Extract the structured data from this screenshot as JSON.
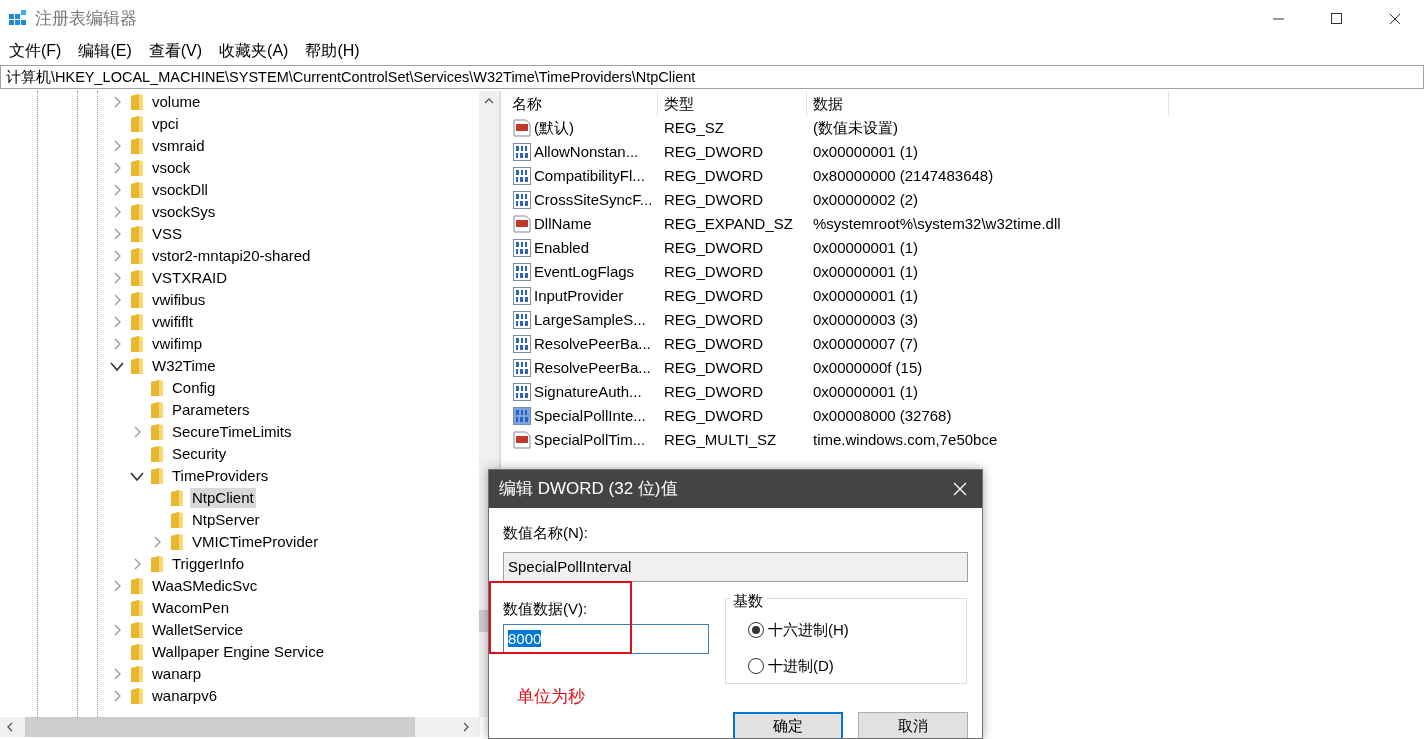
{
  "window": {
    "title": "注册表编辑器"
  },
  "menu": [
    "文件(F)",
    "编辑(E)",
    "查看(V)",
    "收藏夹(A)",
    "帮助(H)"
  ],
  "address": "计算机\\HKEY_LOCAL_MACHINE\\SYSTEM\\CurrentControlSet\\Services\\W32Time\\TimeProviders\\NtpClient",
  "tree": [
    {
      "label": "volume",
      "kind": "node",
      "expanded": false,
      "selected": false
    },
    {
      "label": "vpci",
      "kind": "leaf",
      "selected": false
    },
    {
      "label": "vsmraid",
      "kind": "node",
      "expanded": false,
      "selected": false
    },
    {
      "label": "vsock",
      "kind": "node",
      "expanded": false,
      "selected": false
    },
    {
      "label": "vsockDll",
      "kind": "node",
      "expanded": false,
      "selected": false
    },
    {
      "label": "vsockSys",
      "kind": "node",
      "expanded": false,
      "selected": false
    },
    {
      "label": "VSS",
      "kind": "node",
      "expanded": false,
      "selected": false
    },
    {
      "label": "vstor2-mntapi20-shared",
      "kind": "node",
      "expanded": false,
      "selected": false
    },
    {
      "label": "VSTXRAID",
      "kind": "node",
      "expanded": false,
      "selected": false
    },
    {
      "label": "vwifibus",
      "kind": "node",
      "expanded": false,
      "selected": false
    },
    {
      "label": "vwififlt",
      "kind": "node",
      "expanded": false,
      "selected": false
    },
    {
      "label": "vwifimp",
      "kind": "node",
      "expanded": false,
      "selected": false
    },
    {
      "label": "W32Time",
      "kind": "node",
      "expanded": true,
      "selected": false,
      "children": [
        {
          "label": "Config",
          "kind": "leaf",
          "selected": false
        },
        {
          "label": "Parameters",
          "kind": "leaf",
          "selected": false
        },
        {
          "label": "SecureTimeLimits",
          "kind": "node",
          "expanded": false,
          "selected": false
        },
        {
          "label": "Security",
          "kind": "leaf",
          "selected": false
        },
        {
          "label": "TimeProviders",
          "kind": "node",
          "expanded": true,
          "selected": false,
          "children": [
            {
              "label": "NtpClient",
              "kind": "leaf",
              "selected": true
            },
            {
              "label": "NtpServer",
              "kind": "leaf",
              "selected": false
            },
            {
              "label": "VMICTimeProvider",
              "kind": "node",
              "expanded": false,
              "selected": false
            }
          ]
        },
        {
          "label": "TriggerInfo",
          "kind": "node",
          "expanded": false,
          "selected": false
        }
      ]
    },
    {
      "label": "WaaSMedicSvc",
      "kind": "node",
      "expanded": false,
      "selected": false
    },
    {
      "label": "WacomPen",
      "kind": "leaf",
      "selected": false
    },
    {
      "label": "WalletService",
      "kind": "node",
      "expanded": false,
      "selected": false
    },
    {
      "label": "Wallpaper Engine Service",
      "kind": "leaf",
      "selected": false
    },
    {
      "label": "wanarp",
      "kind": "node",
      "expanded": false,
      "selected": false
    },
    {
      "label": "wanarpv6",
      "kind": "node",
      "expanded": false,
      "selected": false
    }
  ],
  "values": {
    "columns": [
      "名称",
      "类型",
      "数据"
    ],
    "rows": [
      {
        "kind": "string",
        "name": "(默认)",
        "type": "REG_SZ",
        "data": "(数值未设置)",
        "selected": false
      },
      {
        "kind": "binary",
        "name": "AllowNonstan...",
        "type": "REG_DWORD",
        "data": "0x00000001 (1)",
        "selected": false
      },
      {
        "kind": "binary",
        "name": "CompatibilityFl...",
        "type": "REG_DWORD",
        "data": "0x80000000 (2147483648)",
        "selected": false
      },
      {
        "kind": "binary",
        "name": "CrossSiteSyncF...",
        "type": "REG_DWORD",
        "data": "0x00000002 (2)",
        "selected": false
      },
      {
        "kind": "string",
        "name": "DllName",
        "type": "REG_EXPAND_SZ",
        "data": "%systemroot%\\system32\\w32time.dll",
        "selected": false
      },
      {
        "kind": "binary",
        "name": "Enabled",
        "type": "REG_DWORD",
        "data": "0x00000001 (1)",
        "selected": false
      },
      {
        "kind": "binary",
        "name": "EventLogFlags",
        "type": "REG_DWORD",
        "data": "0x00000001 (1)",
        "selected": false
      },
      {
        "kind": "binary",
        "name": "InputProvider",
        "type": "REG_DWORD",
        "data": "0x00000001 (1)",
        "selected": false
      },
      {
        "kind": "binary",
        "name": "LargeSampleS...",
        "type": "REG_DWORD",
        "data": "0x00000003 (3)",
        "selected": false
      },
      {
        "kind": "binary",
        "name": "ResolvePeerBa...",
        "type": "REG_DWORD",
        "data": "0x00000007 (7)",
        "selected": false
      },
      {
        "kind": "binary",
        "name": "ResolvePeerBa...",
        "type": "REG_DWORD",
        "data": "0x0000000f (15)",
        "selected": false
      },
      {
        "kind": "binary",
        "name": "SignatureAuth...",
        "type": "REG_DWORD",
        "data": "0x00000001 (1)",
        "selected": false
      },
      {
        "kind": "binary",
        "name": "SpecialPollInte...",
        "type": "REG_DWORD",
        "data": "0x00008000 (32768)",
        "selected": true
      },
      {
        "kind": "string",
        "name": "SpecialPollTim...",
        "type": "REG_MULTI_SZ",
        "data": "time.windows.com,7e50bce",
        "selected": false
      }
    ]
  },
  "dialog": {
    "title": "编辑 DWORD (32 位)值",
    "name_label": "数值名称(N):",
    "name_value": "SpecialPollInterval",
    "data_label": "数值数据(V):",
    "data_value": "8000",
    "data_value_selected": true,
    "note": "单位为秒",
    "base_label": "基数",
    "radios": [
      {
        "label": "十六进制(H)",
        "selected": true
      },
      {
        "label": "十进制(D)",
        "selected": false
      }
    ],
    "buttons": [
      {
        "label": "确定",
        "focused": true
      },
      {
        "label": "取消",
        "focused": false
      }
    ]
  }
}
